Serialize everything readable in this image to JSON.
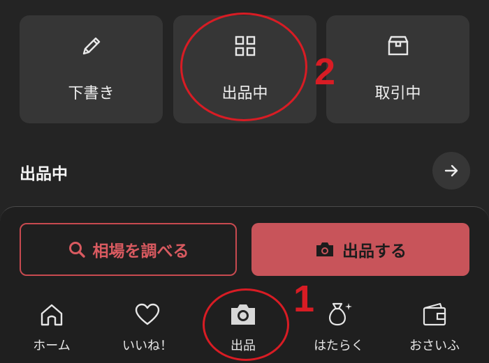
{
  "tiles": [
    {
      "label": "下書き",
      "icon": "pencil-icon"
    },
    {
      "label": "出品中",
      "icon": "grid-icon"
    },
    {
      "label": "取引中",
      "icon": "box-icon"
    }
  ],
  "section": {
    "title": "出品中",
    "arrow_icon": "arrow-right-icon"
  },
  "actions": {
    "search_label": "相場を調べる",
    "sell_label": "出品する"
  },
  "nav": [
    {
      "label": "ホーム",
      "icon": "home-icon"
    },
    {
      "label": "いいね！",
      "icon": "heart-icon"
    },
    {
      "label": "出品",
      "icon": "camera-icon"
    },
    {
      "label": "はたらく",
      "icon": "money-bag-icon"
    },
    {
      "label": "おさいふ",
      "icon": "wallet-icon"
    }
  ],
  "annotations": {
    "num1": "1",
    "num2": "2"
  },
  "colors": {
    "accent": "#c8545a",
    "annotation": "#d81c24",
    "background": "#242424",
    "tile": "#363636"
  }
}
